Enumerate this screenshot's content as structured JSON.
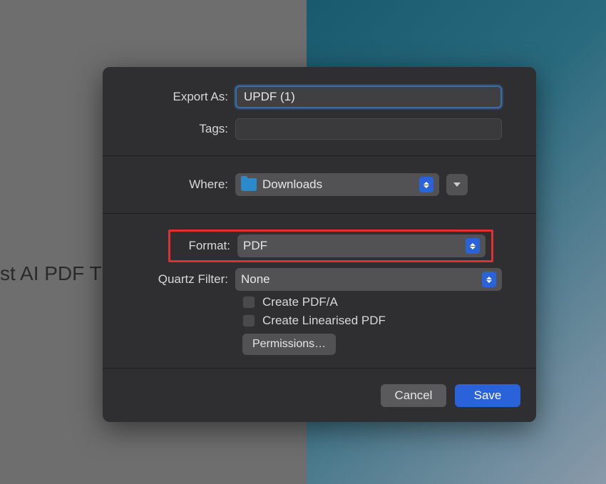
{
  "background": {
    "partial_text": "st AI PDF T"
  },
  "dialog": {
    "export_as": {
      "label": "Export As:",
      "value": "UPDF (1)"
    },
    "tags": {
      "label": "Tags:",
      "value": ""
    },
    "where": {
      "label": "Where:",
      "value": "Downloads"
    },
    "format": {
      "label": "Format:",
      "value": "PDF"
    },
    "quartz_filter": {
      "label": "Quartz Filter:",
      "value": "None"
    },
    "checkbox_pdfa": {
      "label": "Create PDF/A",
      "checked": false
    },
    "checkbox_linearised": {
      "label": "Create Linearised PDF",
      "checked": false
    },
    "permissions_button": "Permissions…",
    "cancel_button": "Cancel",
    "save_button": "Save"
  },
  "colors": {
    "dialog_bg": "#2f2f31",
    "highlight_border": "#e03030",
    "primary_button": "#2962d9"
  }
}
